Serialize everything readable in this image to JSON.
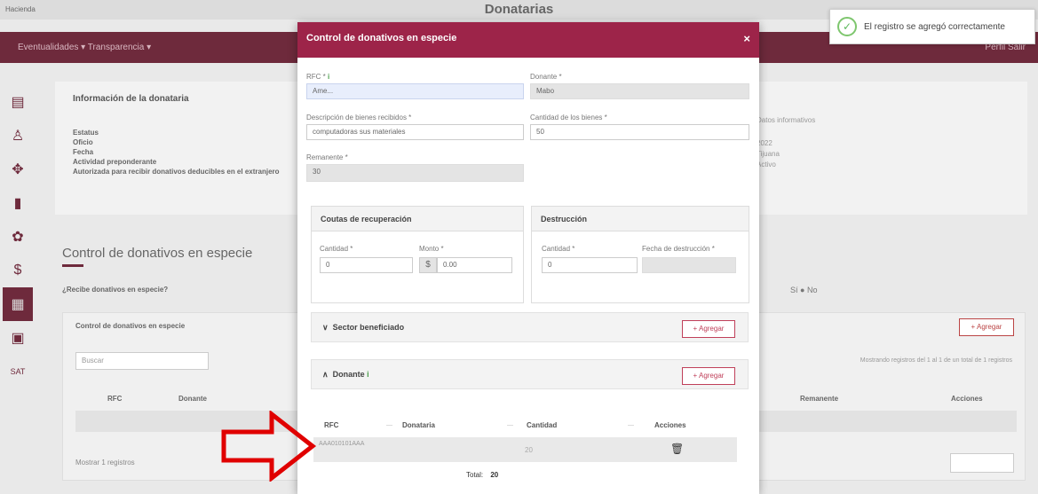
{
  "app": {
    "brand": "Hacienda",
    "title": "Donatarias",
    "nav_links": "Eventualidades ▾   Transparencia ▾",
    "nav_right": "Perfil   Salir",
    "sidebar_icons": [
      "id-card-icon",
      "person-icon",
      "handshake-icon",
      "document-icon",
      "gear-icon",
      "dollar-icon",
      "calendar-icon",
      "book-icon",
      "sat-icon"
    ],
    "sidebar_extra": "SAT"
  },
  "background": {
    "info_title": "Información de la donataria",
    "info_rows": [
      "Estatus",
      "Oficio",
      "Fecha",
      "Actividad preponderante",
      "Autorizada para recibir donativos deducibles en el extranjero"
    ],
    "info_right": [
      "Datos informativos",
      "2022",
      "Tijuana",
      "Activo"
    ],
    "section_title": "Control de donativos en especie",
    "question": "¿Recibe donativos en especie?",
    "radio": "Sí  ●  No",
    "accordion_title": "Control de donativos en especie",
    "add_label": "+ Agregar",
    "search_placeholder": "Buscar",
    "info_text": "Mostrando registros del 1 al 1 de un total de 1 registros",
    "columns": [
      "RFC",
      "Donante",
      "Remanente",
      "Acciones"
    ],
    "show_text": "Mostrar  1  registros"
  },
  "toast": {
    "message": "El registro se agregó correctamente"
  },
  "modal": {
    "title": "Control de donativos en especie",
    "close": "×",
    "rfc_label": "RFC *",
    "rfc_value": "Ame...",
    "donante_label": "Donante *",
    "donante_value": "Mabo",
    "descripcion_label": "Descripción de bienes recibidos *",
    "descripcion_value": "computadoras sus materiales",
    "cantidad_bienes_label": "Cantidad de los bienes *",
    "cantidad_bienes_value": "50",
    "remanente_label": "Remanente *",
    "remanente_value": "30",
    "cuotas_title": "Coutas de recuperación",
    "cuotas_cantidad_label": "Cantidad *",
    "cuotas_cantidad_value": "0",
    "cuotas_monto_label": "Monto *",
    "cuotas_monto_prefix": "$",
    "cuotas_monto_value": "0.00",
    "destruccion_title": "Destrucción",
    "destruccion_cantidad_label": "Cantidad *",
    "destruccion_cantidad_value": "0",
    "destruccion_fecha_label": "Fecha de destrucción *",
    "destruccion_fecha_value": "",
    "sector_title": "Sector beneficiado",
    "sector_add": "+ Agregar",
    "donante_section_title": "Donante",
    "donante_add": "+ Agregar",
    "table": {
      "headers": [
        "RFC",
        "Donataria",
        "Cantidad",
        "Acciones"
      ],
      "row": {
        "rfc": "AAA010101AAA",
        "donataria": "",
        "cantidad": "20"
      },
      "total_label": "Total:",
      "total_value": "20"
    }
  }
}
